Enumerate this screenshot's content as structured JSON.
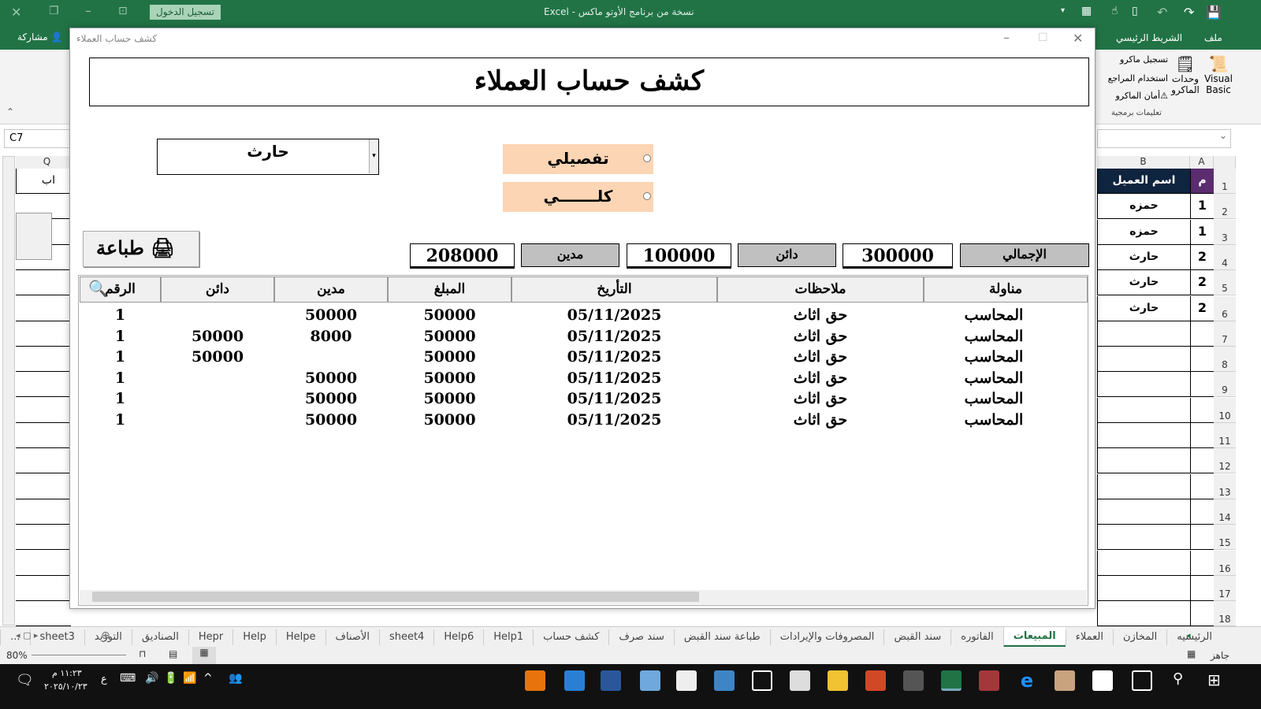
{
  "excel": {
    "title": "نسخة من برنامج الأوتو ماكس  -  Excel",
    "signin": "تسجيل الدخول",
    "share": "مشاركة",
    "tabs": [
      "ملف",
      "الشريط الرئيسي"
    ],
    "ribbon": {
      "visual_basic": "Visual Basic",
      "macros": "وحدات الماكرو",
      "record": "تسجيل ماكرو",
      "relative": "استخدام المراجع",
      "security": "أمان الماكرو",
      "group": "تعليمات برمجية"
    },
    "namebox": "C7",
    "columns": {
      "a": "A",
      "b": "B",
      "q": "Q"
    },
    "q1": "اب",
    "header": {
      "m": "م",
      "name": "اسم العميل"
    },
    "rows": [
      {
        "m": "1",
        "name": "حمزه"
      },
      {
        "m": "1",
        "name": "حمزه"
      },
      {
        "m": "2",
        "name": "حارث"
      },
      {
        "m": "2",
        "name": "حارث"
      },
      {
        "m": "2",
        "name": "حارث"
      }
    ],
    "row_numbers": [
      "1",
      "2",
      "3",
      "4",
      "5",
      "6",
      "7",
      "8",
      "9",
      "10",
      "11",
      "12",
      "13",
      "14",
      "15",
      "16",
      "17",
      "18"
    ],
    "sheets": [
      "الرئيسيه",
      "المخازن",
      "العملاء",
      "المبيعات",
      "الفاتوره",
      "سند القبض",
      "المصروفات والإيرادات",
      "طباعة سند القبض",
      "سند صرف",
      "كشف حساب",
      "Help1",
      "Help6",
      "sheet4",
      "الأصناف",
      "Helpe",
      "Help",
      "Hepr",
      "الصناديق",
      "التوريد",
      "sheet3",
      "..."
    ],
    "active_sheet": "المبيعات",
    "status": "جاهز",
    "zoom": "80%"
  },
  "form": {
    "window_title": "كشف حساب العملاء",
    "header": "كشف حساب العملاء",
    "customer": "حارث",
    "option_detailed": "تفصيلي",
    "option_total": "كلـــــــي",
    "total_label": "الإجمالي",
    "total": "300000",
    "credit_label": "دائن",
    "credit": "100000",
    "debit_label": "مدين",
    "debit": "208000",
    "print": "طباعة",
    "columns": [
      "مناولة",
      "ملاحظات",
      "التأريخ",
      "المبلغ",
      "مدين",
      "دائن",
      "الرقم"
    ],
    "rows": [
      [
        "المحاسب",
        "حق اثاث",
        "05/11/2025",
        "50000",
        "50000",
        "",
        "1"
      ],
      [
        "المحاسب",
        "حق اثاث",
        "05/11/2025",
        "50000",
        "8000",
        "50000",
        "1"
      ],
      [
        "المحاسب",
        "حق اثاث",
        "05/11/2025",
        "50000",
        "",
        "50000",
        "1"
      ],
      [
        "المحاسب",
        "حق اثاث",
        "05/11/2025",
        "50000",
        "50000",
        "",
        "1"
      ],
      [
        "المحاسب",
        "حق اثاث",
        "05/11/2025",
        "50000",
        "50000",
        "",
        "1"
      ],
      [
        "المحاسب",
        "حق اثاث",
        "05/11/2025",
        "50000",
        "50000",
        "",
        "1"
      ]
    ]
  },
  "taskbar": {
    "time": "١١:٢٣ م",
    "date": "٢٠٢٥/١٠/٢٣",
    "lang": "ع"
  },
  "colors": {
    "excel_green": "#217346",
    "option_bg": "#fcd5b4",
    "header_navy": "#0f243e"
  }
}
